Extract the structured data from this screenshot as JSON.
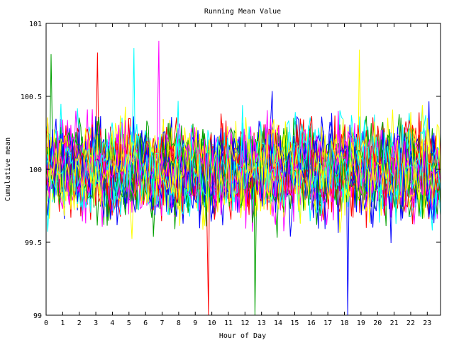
{
  "chart_data": {
    "type": "line",
    "title": "Running Mean Value",
    "xlabel": "Hour of Day",
    "ylabel": "Cumulative mean",
    "xlim": [
      0,
      23.8
    ],
    "ylim": [
      99,
      101
    ],
    "x_ticks": [
      "0",
      "1",
      "2",
      "3",
      "4",
      "5",
      "6",
      "7",
      "8",
      "9",
      "10",
      "11",
      "12",
      "13",
      "14",
      "15",
      "16",
      "17",
      "18",
      "19",
      "20",
      "21",
      "22",
      "23"
    ],
    "y_ticks": [
      "99",
      "99.5",
      "100",
      "100.5",
      "101"
    ],
    "grid": false,
    "legend": "none",
    "series_colors": [
      "#ff0000",
      "#00a000",
      "#0000ff",
      "#ff00ff",
      "#00ffff",
      "#ffff00"
    ],
    "series_count": 36,
    "points_per_series": 240,
    "spread_sd": 0.18,
    "center": 100,
    "notable_extremes": [
      {
        "x": 9.8,
        "y": 99.0
      },
      {
        "x": 12.6,
        "y": 99.0
      },
      {
        "x": 18.2,
        "y": 99.0
      },
      {
        "x": 6.8,
        "y": 100.88
      },
      {
        "x": 5.3,
        "y": 100.83
      },
      {
        "x": 18.9,
        "y": 100.82
      },
      {
        "x": 3.1,
        "y": 100.8
      },
      {
        "x": 0.3,
        "y": 100.79
      }
    ]
  }
}
